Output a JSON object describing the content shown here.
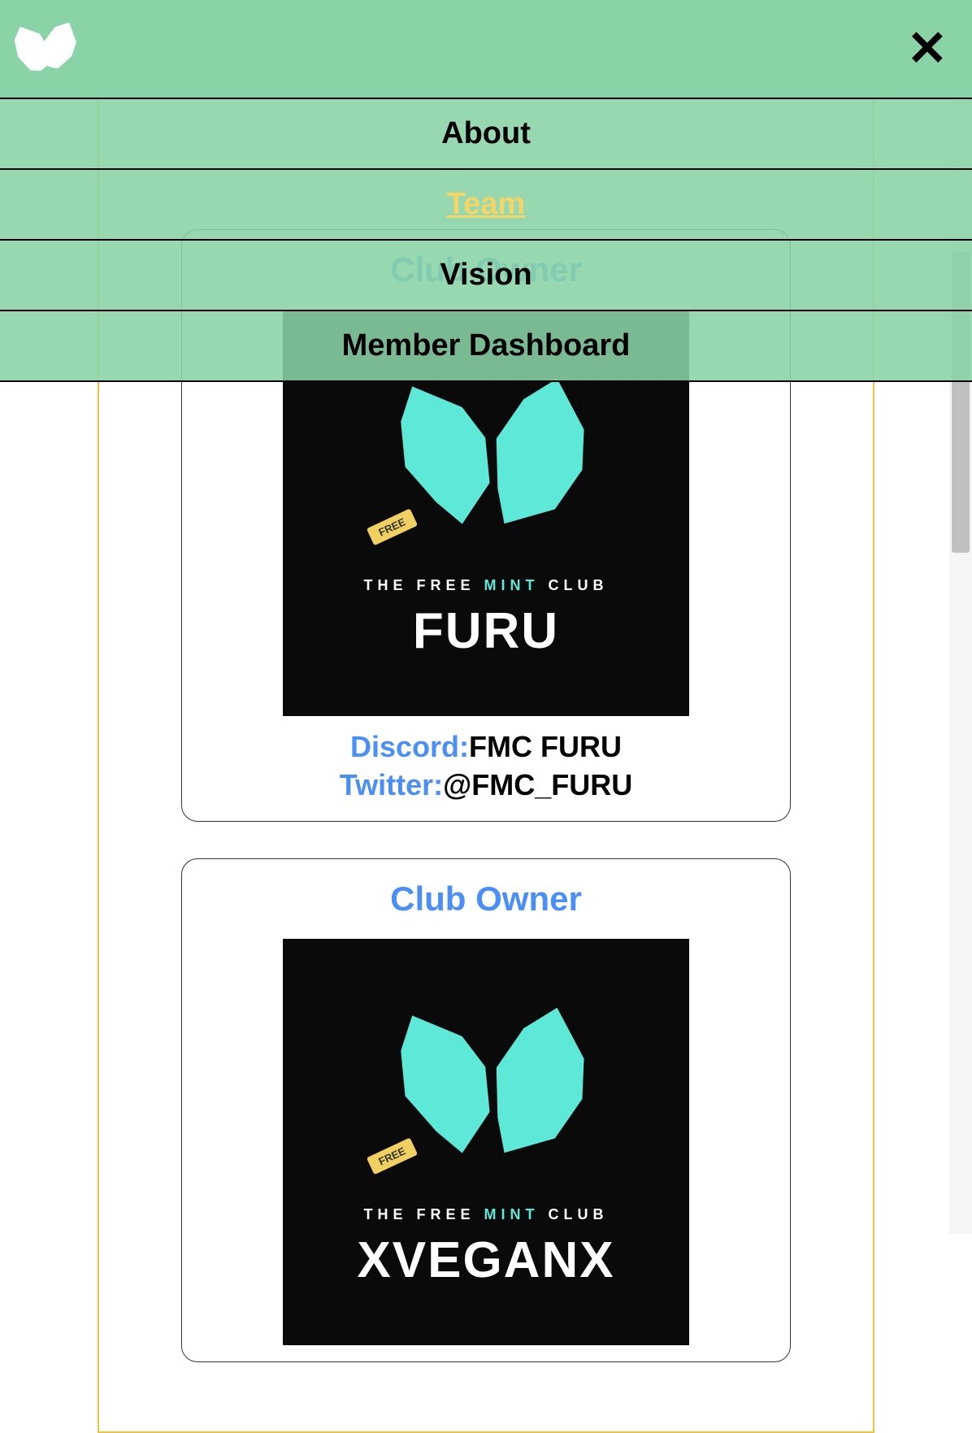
{
  "nav": {
    "items": [
      {
        "label": "About",
        "active": false
      },
      {
        "label": "Team",
        "active": true
      },
      {
        "label": "Vision",
        "active": false
      },
      {
        "label": "Member Dashboard",
        "active": false
      }
    ]
  },
  "clubText": {
    "prefix": "THE FREE",
    "mint": "MINT",
    "suffix": "CLUB"
  },
  "freeTag": "FREE",
  "members": [
    {
      "role": "Club Owner",
      "name": "FURU",
      "discordLabel": "Discord:",
      "discordValue": "FMC FURU",
      "twitterLabel": "Twitter:",
      "twitterValue": "@FMC_FURU"
    },
    {
      "role": "Club Owner",
      "name": "XVEGANX"
    }
  ],
  "scrollbar": {
    "thumbTop": 310,
    "thumbHeight": 370
  }
}
